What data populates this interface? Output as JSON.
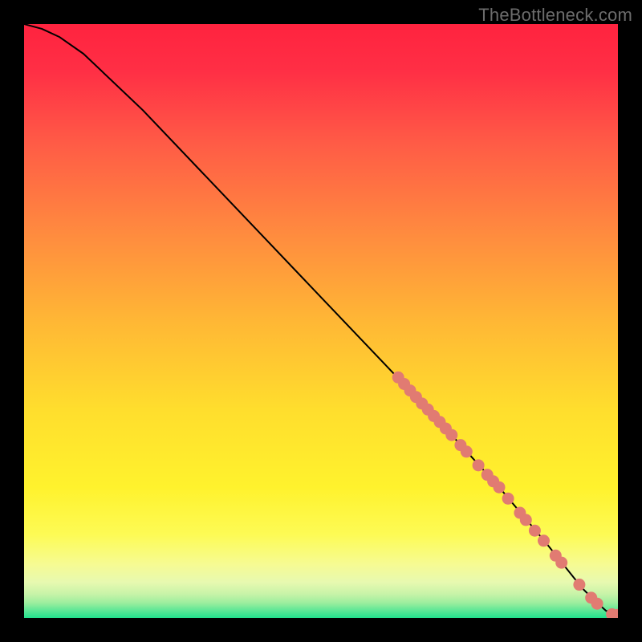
{
  "watermark": "TheBottleneck.com",
  "colors": {
    "dot": "#e17b72",
    "curve": "#000000",
    "green_band": "#2ae28f",
    "green_band_light": "#b9f3a7"
  },
  "chart_data": {
    "type": "line",
    "title": "",
    "xlabel": "",
    "ylabel": "",
    "xlim": [
      0,
      100
    ],
    "ylim": [
      0,
      100
    ],
    "series": [
      {
        "name": "curve",
        "x": [
          0,
          3,
          6,
          10,
          20,
          30,
          40,
          50,
          60,
          70,
          80,
          88,
          92,
          94,
          96,
          98,
          100
        ],
        "y": [
          100,
          99.2,
          97.8,
          95,
          85.5,
          75,
          64.5,
          54,
          43.5,
          33,
          22,
          12.5,
          7.5,
          5,
          3,
          1.2,
          0.5
        ]
      }
    ],
    "dots": [
      {
        "x": 63.0,
        "y": 40.5
      },
      {
        "x": 64.0,
        "y": 39.4
      },
      {
        "x": 65.0,
        "y": 38.3
      },
      {
        "x": 66.0,
        "y": 37.2
      },
      {
        "x": 67.0,
        "y": 36.1
      },
      {
        "x": 68.0,
        "y": 35.1
      },
      {
        "x": 69.0,
        "y": 34.0
      },
      {
        "x": 70.0,
        "y": 33.0
      },
      {
        "x": 71.0,
        "y": 31.9
      },
      {
        "x": 72.0,
        "y": 30.8
      },
      {
        "x": 73.5,
        "y": 29.1
      },
      {
        "x": 74.5,
        "y": 28.0
      },
      {
        "x": 76.5,
        "y": 25.7
      },
      {
        "x": 78.0,
        "y": 24.1
      },
      {
        "x": 79.0,
        "y": 23.0
      },
      {
        "x": 80.0,
        "y": 22.0
      },
      {
        "x": 81.5,
        "y": 20.1
      },
      {
        "x": 83.5,
        "y": 17.7
      },
      {
        "x": 84.5,
        "y": 16.5
      },
      {
        "x": 86.0,
        "y": 14.7
      },
      {
        "x": 87.5,
        "y": 13.0
      },
      {
        "x": 89.5,
        "y": 10.5
      },
      {
        "x": 90.5,
        "y": 9.3
      },
      {
        "x": 93.5,
        "y": 5.6
      },
      {
        "x": 95.5,
        "y": 3.4
      },
      {
        "x": 96.5,
        "y": 2.4
      },
      {
        "x": 99.0,
        "y": 0.6
      },
      {
        "x": 100.0,
        "y": 0.5
      }
    ]
  }
}
